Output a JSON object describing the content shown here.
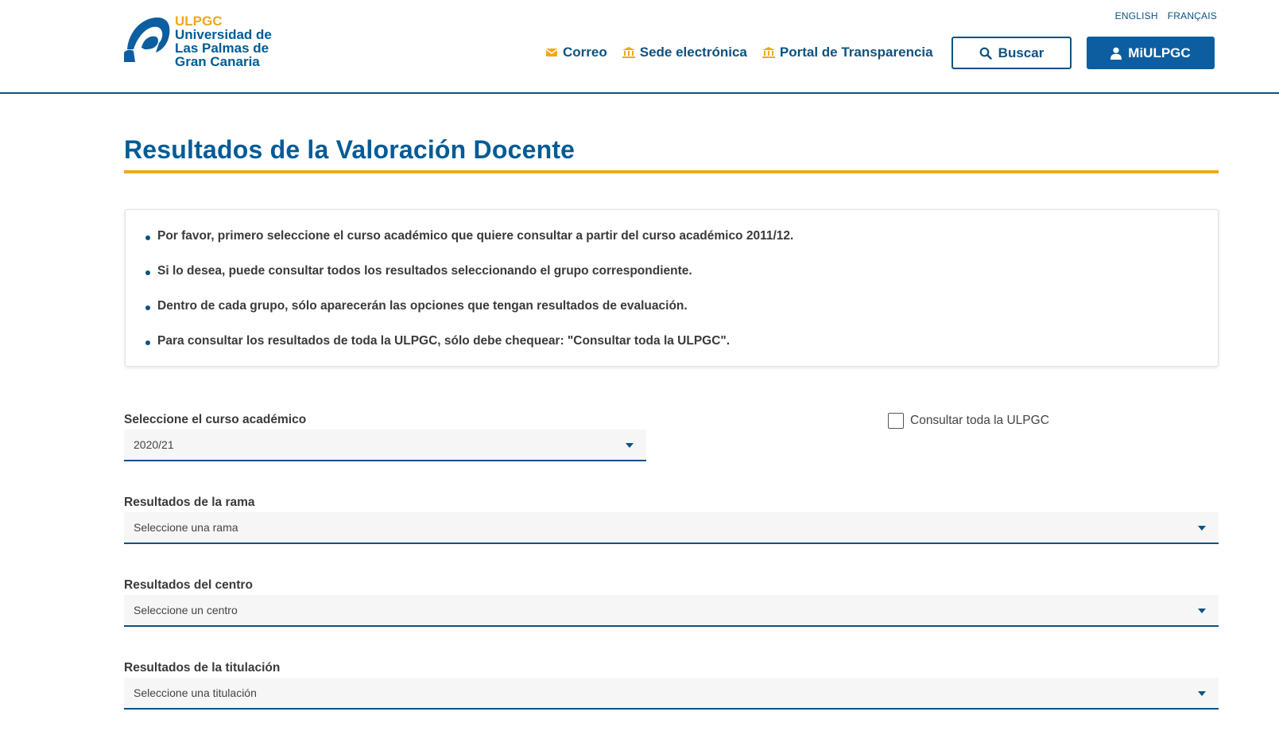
{
  "header": {
    "logo": {
      "acronym": "ULPGC",
      "line1": "Universidad de",
      "line2": "Las Palmas de",
      "line3": "Gran Canaria"
    },
    "languages": [
      "ENGLISH",
      "FRANÇAIS"
    ],
    "nav": [
      {
        "label": "Correo",
        "icon": "mail-icon"
      },
      {
        "label": "Sede electrónica",
        "icon": "institution-icon"
      },
      {
        "label": "Portal de Transparencia",
        "icon": "institution-icon"
      }
    ],
    "search_label": "Buscar",
    "account_label": "MiULPGC"
  },
  "page": {
    "title": "Resultados de la Valoración Docente",
    "info": [
      "Por favor, primero seleccione el curso académico que quiere consultar a partir del curso académico 2011/12.",
      "Si lo desea, puede consultar todos los resultados seleccionando el grupo correspondiente.",
      "Dentro de cada grupo, sólo aparecerán las opciones que tengan resultados de evaluación.",
      "Para consultar los resultados de toda la ULPGC, sólo debe chequear: \"Consultar toda la ULPGC\"."
    ]
  },
  "form": {
    "curso": {
      "label": "Seleccione el curso académico",
      "value": "2020/21"
    },
    "toda": {
      "label": "Consultar toda la ULPGC",
      "checked": false
    },
    "rama": {
      "label": "Resultados de la rama",
      "value": "Seleccione una rama"
    },
    "centro": {
      "label": "Resultados del centro",
      "value": "Seleccione un centro"
    },
    "titulacion": {
      "label": "Resultados de la titulación",
      "value": "Seleccione una titulación"
    }
  },
  "colors": {
    "primary": "#0c5282",
    "accent": "#f2a71b",
    "title": "#005b96"
  }
}
